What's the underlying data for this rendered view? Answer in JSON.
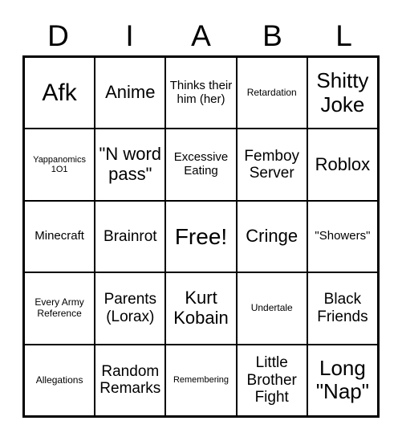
{
  "card": {
    "title_letters": [
      "D",
      "I",
      "A",
      "B",
      "L"
    ],
    "free_space_label": "Free!",
    "rows": [
      [
        {
          "label": "Afk",
          "size": "fs-xxl"
        },
        {
          "label": "Anime",
          "size": "fs-lg"
        },
        {
          "label": "Thinks their him (her)",
          "size": "fs-sm"
        },
        {
          "label": "Retardation",
          "size": "fs-xs"
        },
        {
          "label": "Shitty Joke",
          "size": "fs-xl"
        }
      ],
      [
        {
          "label": "Yappanomics 1O1",
          "size": "fs-xxs"
        },
        {
          "label": "\"N word pass\"",
          "size": "fs-lg"
        },
        {
          "label": "Excessive Eating",
          "size": "fs-sm"
        },
        {
          "label": "Femboy Server",
          "size": "fs-md"
        },
        {
          "label": "Roblox",
          "size": "fs-lg"
        }
      ],
      [
        {
          "label": "Minecraft",
          "size": "fs-sm"
        },
        {
          "label": "Brainrot",
          "size": "fs-md"
        },
        {
          "label": "Free!",
          "size": "free"
        },
        {
          "label": "Cringe",
          "size": "fs-lg"
        },
        {
          "label": "\"Showers\"",
          "size": "fs-sm"
        }
      ],
      [
        {
          "label": "Every Army Reference",
          "size": "fs-xs"
        },
        {
          "label": "Parents (Lorax)",
          "size": "fs-md"
        },
        {
          "label": "Kurt Kobain",
          "size": "fs-lg"
        },
        {
          "label": "Undertale",
          "size": "fs-xs"
        },
        {
          "label": "Black Friends",
          "size": "fs-md"
        }
      ],
      [
        {
          "label": "Allegations",
          "size": "fs-xs"
        },
        {
          "label": "Random Remarks",
          "size": "fs-md"
        },
        {
          "label": "Remembering",
          "size": "fs-xxs"
        },
        {
          "label": "Little Brother Fight",
          "size": "fs-md"
        },
        {
          "label": "Long \"Nap\"",
          "size": "fs-xl"
        }
      ]
    ]
  },
  "colors": {
    "grid_line": "#000000",
    "text": "#000000",
    "background": "#ffffff"
  }
}
